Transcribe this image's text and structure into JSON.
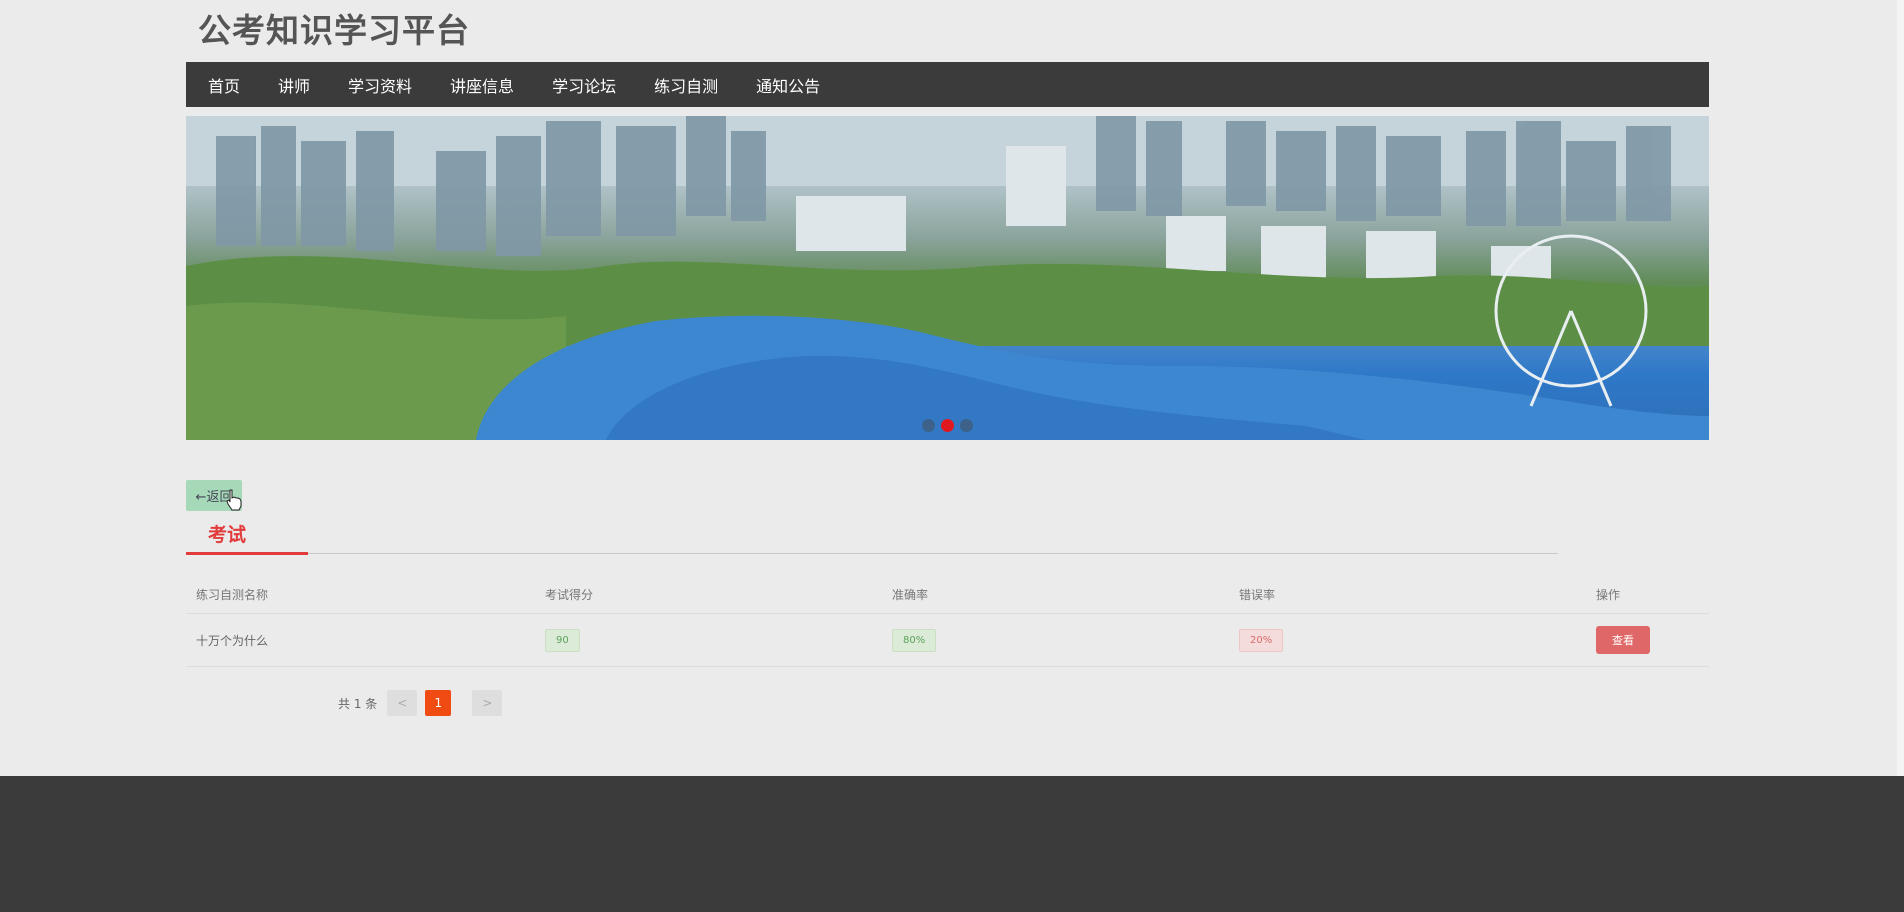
{
  "site": {
    "title": "公考知识学习平台"
  },
  "nav": {
    "items": [
      {
        "label": "首页"
      },
      {
        "label": "讲师"
      },
      {
        "label": "学习资料"
      },
      {
        "label": "讲座信息"
      },
      {
        "label": "学习论坛"
      },
      {
        "label": "练习自测"
      },
      {
        "label": "通知公告"
      }
    ]
  },
  "banner": {
    "slides": 3,
    "active_slide": 2,
    "active_color": "#e0191f"
  },
  "back_button": {
    "label": "←返回"
  },
  "tab": {
    "label": "考试"
  },
  "table": {
    "headers": [
      "练习自测名称",
      "考试得分",
      "准确率",
      "错误率",
      "操作"
    ],
    "rows": [
      {
        "name": "十万个为什么",
        "score": "90",
        "accuracy": "80%",
        "error_rate": "20%",
        "action": "查看"
      }
    ]
  },
  "pagination": {
    "total": "共 1 条",
    "prev": "<",
    "current": "1",
    "next": ">"
  },
  "colors": {
    "nav_bg": "#3b3b3b",
    "accent": "#e23b3b",
    "page_active": "#ef4b12",
    "footer_bg": "#3b3b3b"
  }
}
